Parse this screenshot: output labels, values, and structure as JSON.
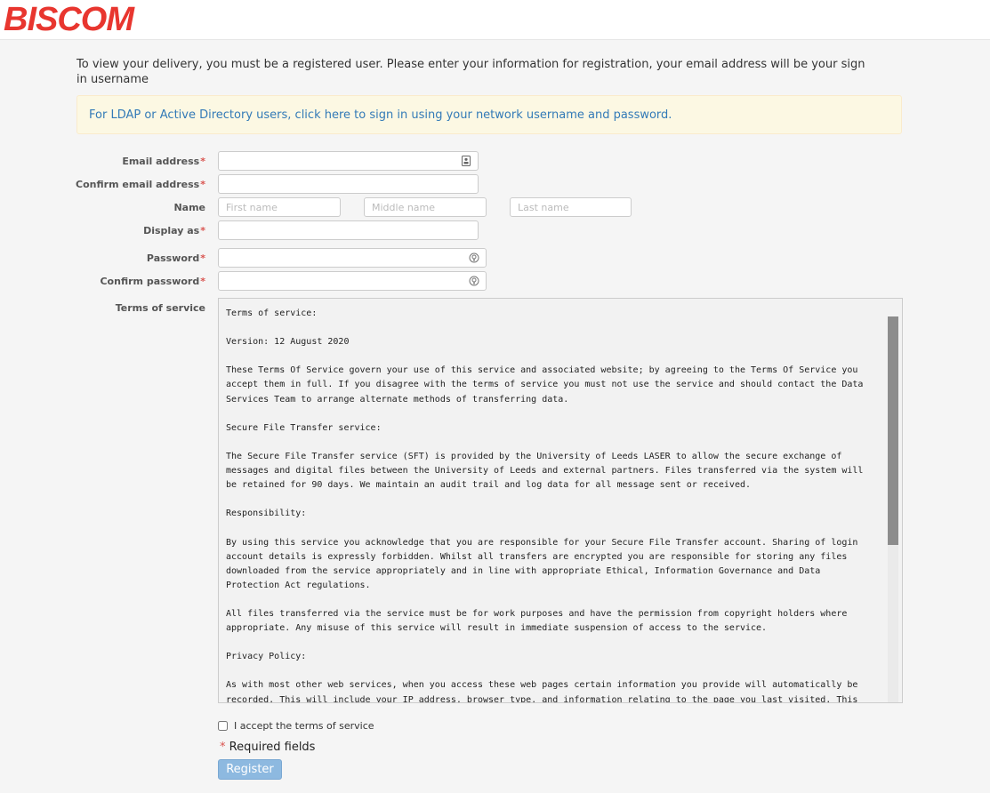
{
  "brand": {
    "logo_text": "BISCOM",
    "color": "#e8362f"
  },
  "intro_text": "To view your delivery, you must be a registered user. Please enter your information for registration, your email address will be your sign in username",
  "ldap_link": "For LDAP or Active Directory users, click here to sign in using your network username and password.",
  "form": {
    "email_label": "Email address",
    "confirm_email_label": "Confirm email address",
    "name_label": "Name",
    "first_name_placeholder": "First name",
    "middle_name_placeholder": "Middle name",
    "last_name_placeholder": "Last name",
    "display_as_label": "Display as",
    "password_label": "Password",
    "confirm_password_label": "Confirm password",
    "terms_label": "Terms of service",
    "required_marker": "*"
  },
  "terms_text": "Terms of service:\n\nVersion: 12 August 2020\n\nThese Terms Of Service govern your use of this service and associated website; by agreeing to the Terms Of Service you\naccept them in full. If you disagree with the terms of service you must not use the service and should contact the Data\nServices Team to arrange alternate methods of transferring data.\n\nSecure File Transfer service:\n\nThe Secure File Transfer service (SFT) is provided by the University of Leeds LASER to allow the secure exchange of\nmessages and digital files between the University of Leeds and external partners. Files transferred via the system will\nbe retained for 90 days. We maintain an audit trail and log data for all message sent or received.\n\nResponsibility:\n\nBy using this service you acknowledge that you are responsible for your Secure File Transfer account. Sharing of login\naccount details is expressly forbidden. Whilst all transfers are encrypted you are responsible for storing any files\ndownloaded from the service appropriately and in line with appropriate Ethical, Information Governance and Data\nProtection Act regulations.\n\nAll files transferred via the service must be for work purposes and have the permission from copyright holders where\nappropriate. Any misuse of this service will result in immediate suspension of access to the service.\n\nPrivacy Policy:\n\nAs with most other web services, when you access these web pages certain information you provide will automatically be\nrecorded. This will include your IP address, browser type, and information relating to the page you last visited. This",
  "accept_label": "I accept the terms of service",
  "required_note": "Required fields",
  "register_button": "Register",
  "icons": {
    "email": "contact-card-icon",
    "password": "password-reveal-icon"
  }
}
